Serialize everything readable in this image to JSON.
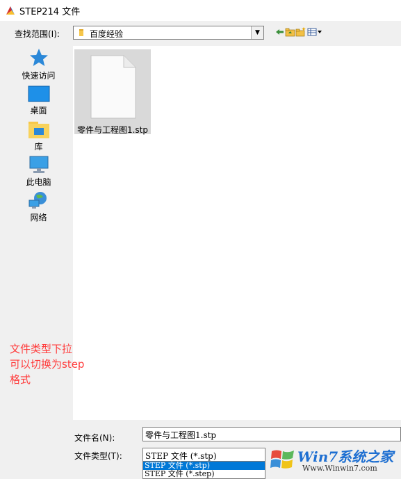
{
  "window": {
    "title": "STEP214 文件"
  },
  "lookin": {
    "label": "查找范围(I):",
    "value": "百度经验"
  },
  "toolbar": {
    "icons": [
      "back-icon",
      "up-folder-icon",
      "new-folder-icon",
      "view-menu-icon"
    ]
  },
  "places": [
    {
      "label": "快速访问",
      "icon": "star-icon"
    },
    {
      "label": "桌面",
      "icon": "desktop-icon"
    },
    {
      "label": "库",
      "icon": "library-icon"
    },
    {
      "label": "此电脑",
      "icon": "computer-icon"
    },
    {
      "label": "网络",
      "icon": "network-icon"
    }
  ],
  "files": [
    {
      "name": "零件与工程图1.stp"
    }
  ],
  "annotation": {
    "line1": "文件类型下拉",
    "line2": "可以切换为step",
    "line3": "格式"
  },
  "filename": {
    "label": "文件名(N):",
    "value": "零件与工程图1.stp"
  },
  "filetype": {
    "label": "文件类型(T):",
    "value": "STEP 文件 (*.stp)",
    "options": [
      "STEP 文件 (*.stp)",
      "STEP 文件 (*.step)"
    ]
  },
  "watermark": {
    "brand": "Win7系统之家",
    "url": "Www.Winwin7.com"
  },
  "colors": {
    "selection": "#0078d7",
    "annotation": "#ff3b3b",
    "watermark": "#1e6fd1"
  }
}
